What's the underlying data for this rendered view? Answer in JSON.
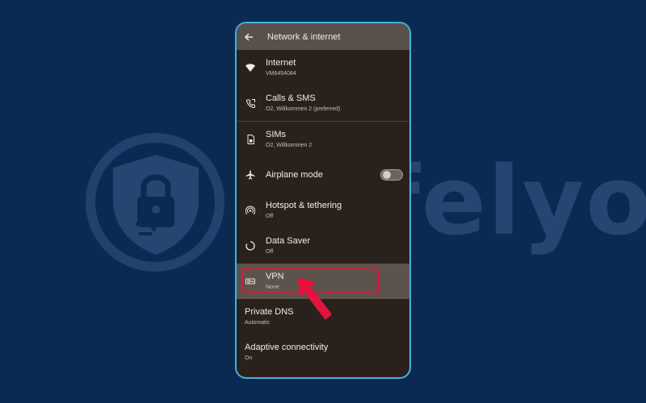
{
  "header": {
    "title": "Network & internet"
  },
  "items": [
    {
      "title": "Internet",
      "subtitle": "VM6454084",
      "icon": "wifi-icon"
    },
    {
      "title": "Calls & SMS",
      "subtitle": "O2, Willkommen 2 (preferred)",
      "icon": "phone-icon"
    },
    {
      "title": "SIMs",
      "subtitle": "O2, Willkommen 2",
      "icon": "sim-icon"
    },
    {
      "title": "Airplane mode",
      "subtitle": "",
      "icon": "airplane-icon",
      "toggle": "off"
    },
    {
      "title": "Hotspot & tethering",
      "subtitle": "Off",
      "icon": "hotspot-icon"
    },
    {
      "title": "Data Saver",
      "subtitle": "Off",
      "icon": "data-saver-icon"
    },
    {
      "title": "VPN",
      "subtitle": "None",
      "icon": "vpn-key-icon"
    },
    {
      "title": "Private DNS",
      "subtitle": "Automatic"
    },
    {
      "title": "Adaptive connectivity",
      "subtitle": "On"
    }
  ],
  "watermark": {
    "text": "Safelyo"
  },
  "colors": {
    "background": "#0b2a52",
    "phone_border": "#3fb4dc",
    "highlight": "#e3133e",
    "surface": "#2a211d"
  }
}
